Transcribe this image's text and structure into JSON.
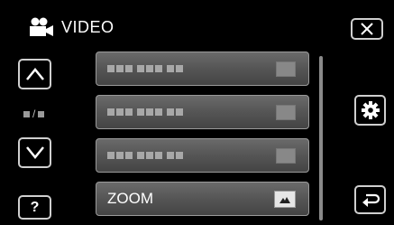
{
  "header": {
    "title": "VIDEO",
    "icon": "video-camera-icon"
  },
  "buttons": {
    "close": "close-icon",
    "up": "chevron-up-icon",
    "down": "chevron-down-icon",
    "help_label": "?",
    "settings": "gear-icon",
    "back": "return-icon"
  },
  "page_indicator": {
    "separator": "/"
  },
  "menu": {
    "items": [
      {
        "label": "",
        "placeholder": true
      },
      {
        "label": "",
        "placeholder": true
      },
      {
        "label": "",
        "placeholder": true
      },
      {
        "label": "ZOOM",
        "value_icon": "mountain-icon"
      }
    ]
  }
}
